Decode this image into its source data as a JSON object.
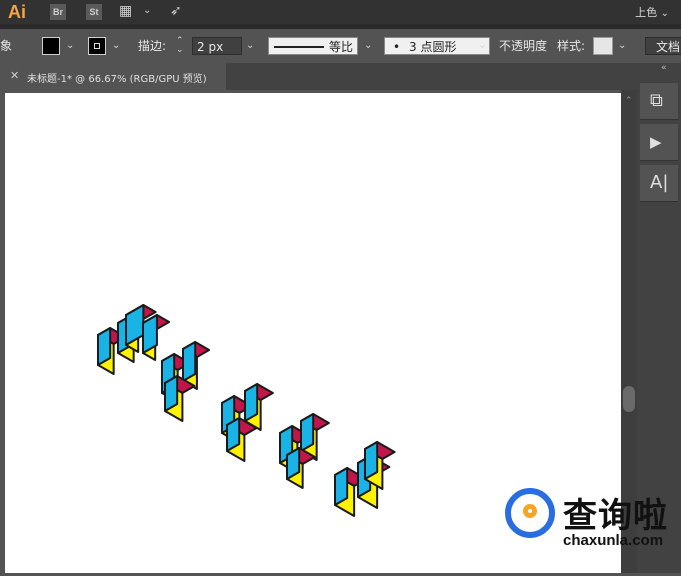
{
  "menubar": {
    "app_logo": "Ai",
    "br": "Br",
    "st": "St",
    "workspace": "上色"
  },
  "control": {
    "object_label": "象",
    "stroke_label": "描边:",
    "stroke_weight": "2 px",
    "profile_label": "等比",
    "brush_label": "3 点圆形",
    "opacity_label": "不透明度",
    "style_label": "样式:",
    "doc_label": "文档"
  },
  "document": {
    "tab_title": "未标题-1* @ 66.67% (RGB/GPU 预览)"
  },
  "right_panel": {
    "buttons": [
      "export-icon",
      "play-icon",
      "character-icon"
    ]
  },
  "watermark": {
    "name_cn": "查询啦",
    "domain": "chaxunla.com"
  },
  "colors": {
    "cube_top": "#c0164a",
    "cube_left": "#1ab3e6",
    "cube_right": "#fff200",
    "accent_blue": "#2a6de0",
    "accent_orange": "#f5a623"
  }
}
